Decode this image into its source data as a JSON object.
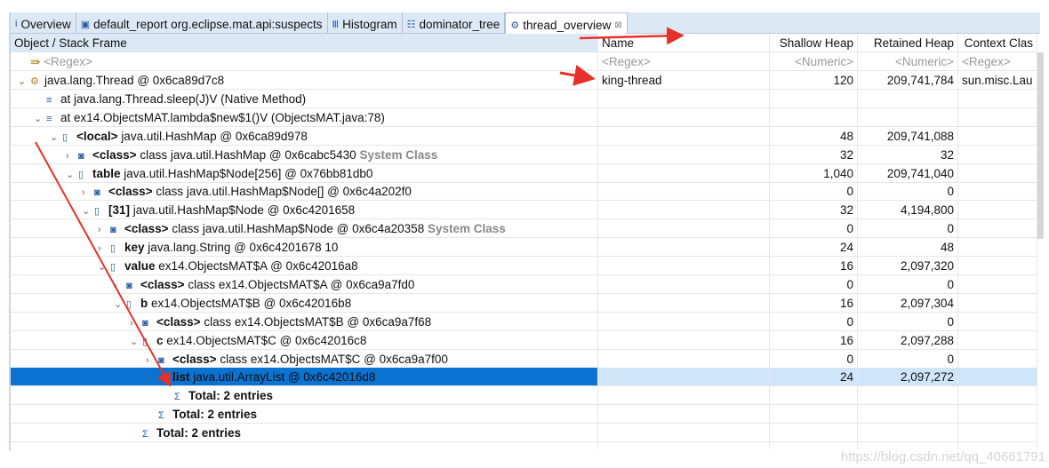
{
  "tabs": [
    {
      "icon": "info-icon",
      "label": "Overview"
    },
    {
      "icon": "report-icon",
      "label": "default_report  org.eclipse.mat.api:suspects"
    },
    {
      "icon": "histogram-icon",
      "label": "Histogram"
    },
    {
      "icon": "dominator-tree-icon",
      "label": "dominator_tree"
    },
    {
      "icon": "thread-icon",
      "label": "thread_overview",
      "active": true,
      "close": "⊠"
    }
  ],
  "columns": [
    "Object / Stack Frame",
    "Name",
    "Shallow Heap",
    "Retained Heap",
    "Context Clas"
  ],
  "filters": [
    "<Regex>",
    "<Regex>",
    "<Numeric>",
    "<Numeric>",
    "<Regex>"
  ],
  "rows": [
    {
      "level": 0,
      "exp": "v",
      "icon": "thread-icon",
      "bold": "",
      "text": "java.lang.Thread @ 0x6ca89d7c8",
      "name": "king-thread",
      "shallow": "120",
      "retained": "209,741,784",
      "ctx": "sun.misc.Lau"
    },
    {
      "level": 1,
      "exp": "",
      "icon": "stack-frame-icon",
      "bold": "",
      "text": "at java.lang.Thread.sleep(J)V (Native Method)"
    },
    {
      "level": 1,
      "exp": "v",
      "icon": "stack-frame-icon",
      "bold": "",
      "text": "at ex14.ObjectsMAT.lambda$new$1()V (ObjectsMAT.java:78)"
    },
    {
      "level": 2,
      "exp": "v",
      "icon": "object-icon",
      "bold": "<local>",
      "text": "java.util.HashMap @ 0x6ca89d978",
      "shallow": "48",
      "retained": "209,741,088"
    },
    {
      "level": 3,
      "exp": ">",
      "icon": "class-icon",
      "bold": "<class>",
      "text": "class java.util.HashMap @ 0x6cabc5430",
      "tag": "System Class",
      "shallow": "32",
      "retained": "32"
    },
    {
      "level": 3,
      "exp": "v",
      "icon": "object-icon",
      "bold": "table",
      "text": "java.util.HashMap$Node[256] @ 0x76bb81db0",
      "shallow": "1,040",
      "retained": "209,741,040"
    },
    {
      "level": 4,
      "exp": ">",
      "icon": "class-icon",
      "bold": "<class>",
      "text": "class java.util.HashMap$Node[] @ 0x6c4a202f0",
      "shallow": "0",
      "retained": "0"
    },
    {
      "level": 4,
      "exp": "v",
      "icon": "object-icon",
      "bold": "[31]",
      "text": "java.util.HashMap$Node @ 0x6c4201658",
      "shallow": "32",
      "retained": "4,194,800"
    },
    {
      "level": 5,
      "exp": ">",
      "icon": "class-icon",
      "bold": "<class>",
      "text": "class java.util.HashMap$Node @ 0x6c4a20358",
      "tag": "System Class",
      "shallow": "0",
      "retained": "0"
    },
    {
      "level": 5,
      "exp": ">",
      "icon": "object-icon",
      "bold": "key",
      "text": "java.lang.String @ 0x6c4201678  10",
      "shallow": "24",
      "retained": "48"
    },
    {
      "level": 5,
      "exp": "v",
      "icon": "object-icon",
      "bold": "value",
      "text": "ex14.ObjectsMAT$A @ 0x6c42016a8",
      "shallow": "16",
      "retained": "2,097,320"
    },
    {
      "level": 6,
      "exp": ">",
      "icon": "class-icon",
      "bold": "<class>",
      "text": "class ex14.ObjectsMAT$A @ 0x6ca9a7fd0",
      "shallow": "0",
      "retained": "0"
    },
    {
      "level": 6,
      "exp": "v",
      "icon": "object-icon",
      "bold": "b",
      "text": "ex14.ObjectsMAT$B @ 0x6c42016b8",
      "shallow": "16",
      "retained": "2,097,304"
    },
    {
      "level": 7,
      "exp": ">",
      "icon": "class-icon",
      "bold": "<class>",
      "text": "class ex14.ObjectsMAT$B @ 0x6ca9a7f68",
      "shallow": "0",
      "retained": "0"
    },
    {
      "level": 7,
      "exp": "v",
      "icon": "object-icon",
      "bold": "c",
      "text": "ex14.ObjectsMAT$C @ 0x6c42016c8",
      "shallow": "16",
      "retained": "2,097,288"
    },
    {
      "level": 8,
      "exp": ">",
      "icon": "class-icon",
      "bold": "<class>",
      "text": "class ex14.ObjectsMAT$C @ 0x6ca9a7f00",
      "shallow": "0",
      "retained": "0"
    },
    {
      "level": 8,
      "exp": ">",
      "icon": "object-icon",
      "bold": "list",
      "text": "java.util.ArrayList @ 0x6c42016d8",
      "shallow": "24",
      "retained": "2,097,272",
      "selected": true
    },
    {
      "level": 9,
      "exp": "",
      "icon": "sum-icon",
      "bold": "Total: 2 entries",
      "text": ""
    },
    {
      "level": 8,
      "exp": "",
      "icon": "sum-icon",
      "bold": "Total: 2 entries",
      "text": ""
    },
    {
      "level": 7,
      "exp": "",
      "icon": "sum-icon",
      "bold": "Total: 2 entries",
      "text": ""
    }
  ],
  "watermark": "https://blog.csdn.net/qq_40661791",
  "colors": {
    "selection": "#0a72d0",
    "annotation_arrow": "#e8302a"
  }
}
